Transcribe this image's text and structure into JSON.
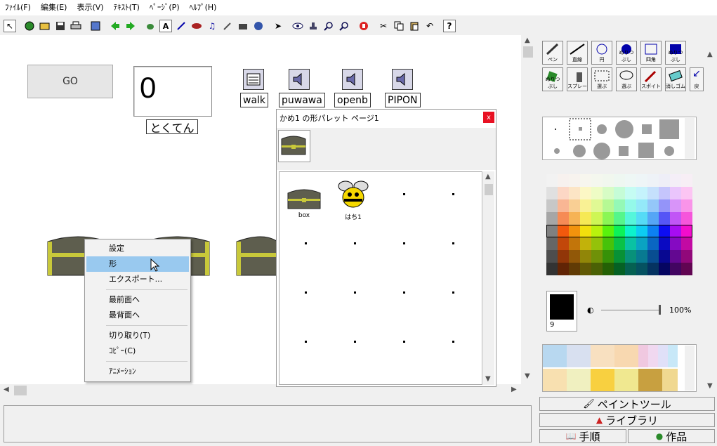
{
  "menubar": [
    "ﾌｧｲﾙ(F)",
    "編集(E)",
    "表示(V)",
    "ﾃｷｽﾄ(T)",
    "ﾍﾟｰｼﾞ(P)",
    "ﾍﾙﾌﾟ(H)"
  ],
  "toolbar_icons": [
    "pointer-icon",
    "globe-icon",
    "open-folder-icon",
    "save-icon",
    "print-icon",
    "page-list-icon",
    "back-arrow-icon",
    "forward-arrow-icon",
    "turtle-icon",
    "text-a-icon",
    "paint-icon",
    "record-icon",
    "music-note-icon",
    "pen-icon",
    "movie-icon",
    "world-icon",
    "select-arrow-icon",
    "eye-icon",
    "stamp-icon",
    "zoom-in-icon",
    "zoom-out-icon",
    "stop-hand-icon",
    "cut-icon",
    "copy-icon",
    "paste-icon",
    "undo-icon",
    "help-icon"
  ],
  "stage": {
    "go_button": "GO",
    "score_value": "0",
    "score_label": "とくてん",
    "sounds": [
      {
        "label": "walk",
        "icon": "music-score-icon"
      },
      {
        "label": "puwawa",
        "icon": "speaker-icon"
      },
      {
        "label": "openb",
        "icon": "speaker-icon"
      },
      {
        "label": "PIPON",
        "icon": "speaker-icon"
      }
    ]
  },
  "context_menu": [
    {
      "label": "設定",
      "selected": false
    },
    {
      "label": "形",
      "selected": true
    },
    {
      "label": "エクスポート...",
      "selected": false
    },
    {
      "sep": true
    },
    {
      "label": "最前面へ",
      "selected": false
    },
    {
      "label": "最背面へ",
      "selected": false
    },
    {
      "sep": true
    },
    {
      "label": "切り取り(T)",
      "selected": false
    },
    {
      "label": "ｺﾋﾟｰ(C)",
      "selected": false
    },
    {
      "sep": true
    },
    {
      "label": "ｱﾆﾒｰｼｮﾝ",
      "selected": false
    }
  ],
  "palette": {
    "title": "かめ1 の形パレット ページ1",
    "close": "x",
    "shapes": [
      {
        "name": "box"
      },
      {
        "name": "はち1"
      }
    ]
  },
  "paint": {
    "tools_row1": [
      "ペン",
      "直線",
      "円",
      "ぬりつぶし",
      "四角",
      "ぬりつぶし"
    ],
    "tools_row2": [
      "ぬりつぶし",
      "スプレー",
      "選ぶ",
      "選ぶ",
      "スポイト",
      "消しゴム",
      "戻"
    ],
    "current_color": "#000000",
    "color_number": "9",
    "opacity": "100%"
  },
  "tabs": {
    "paint_tool": "ペイントツール",
    "library": "ライブラリ",
    "procedure": "手順",
    "work": "作品"
  },
  "colors": {
    "selected_menu": "#99c9ef",
    "close_button": "#e81123",
    "stage_bg": "#ffffff"
  }
}
